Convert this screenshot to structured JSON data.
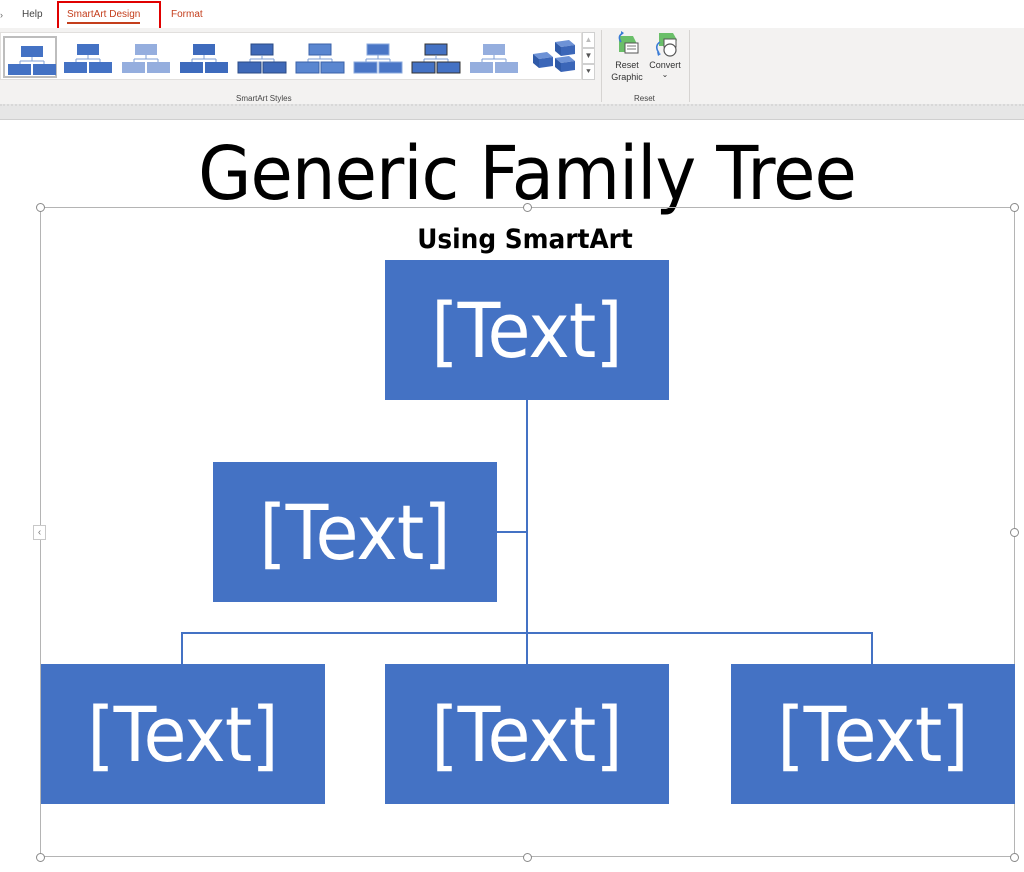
{
  "ribbon": {
    "tabs": [
      {
        "label": "Help",
        "selected": false,
        "contextual": false
      },
      {
        "label": "SmartArt Design",
        "selected": true,
        "contextual": true
      },
      {
        "label": "Format",
        "selected": false,
        "contextual": true
      }
    ],
    "gallery": {
      "styles": [
        {
          "name": "Simple Fill",
          "variant": "flat",
          "selected": true
        },
        {
          "name": "White Outline",
          "variant": "flat",
          "selected": false
        },
        {
          "name": "Subtle Effect",
          "variant": "light-textured",
          "selected": false
        },
        {
          "name": "Moderate Effect",
          "variant": "flat-dark",
          "selected": false
        },
        {
          "name": "Intense Effect",
          "variant": "shadowed",
          "selected": false
        },
        {
          "name": "Polished",
          "variant": "gradient",
          "selected": false
        },
        {
          "name": "Inset",
          "variant": "inset",
          "selected": false
        },
        {
          "name": "Cartoon",
          "variant": "outlined-dark",
          "selected": false
        },
        {
          "name": "Powder",
          "variant": "light-textured",
          "selected": false
        },
        {
          "name": "Brick Scene",
          "variant": "3d",
          "selected": false
        }
      ],
      "scroll_up": "▲",
      "scroll_down": "▼",
      "more": "⯆"
    },
    "groups": {
      "styles_label": "SmartArt Styles",
      "reset_label": "Reset"
    },
    "buttons": {
      "reset_graphic_line1": "Reset",
      "reset_graphic_line2": "Graphic",
      "convert_label": "Convert",
      "convert_caret": "⌄"
    }
  },
  "slide": {
    "title": "Generic Family Tree",
    "subtitle": "Using SmartArt",
    "collapse_glyph": "‹",
    "smartart": {
      "layout": "organization-chart",
      "fill_color": "#4472C4",
      "text_color": "#FFFFFF",
      "nodes": [
        {
          "role": "top",
          "text": "[Text]"
        },
        {
          "role": "assistant",
          "text": "[Text]"
        },
        {
          "role": "child",
          "text": "[Text]"
        },
        {
          "role": "child",
          "text": "[Text]"
        },
        {
          "role": "child",
          "text": "[Text]"
        }
      ]
    }
  },
  "colors": {
    "accent_red": "#C43E1C",
    "highlight_box": "#E00000",
    "ribbon_bg": "#F3F2F1",
    "node_fill": "#4472C4"
  }
}
